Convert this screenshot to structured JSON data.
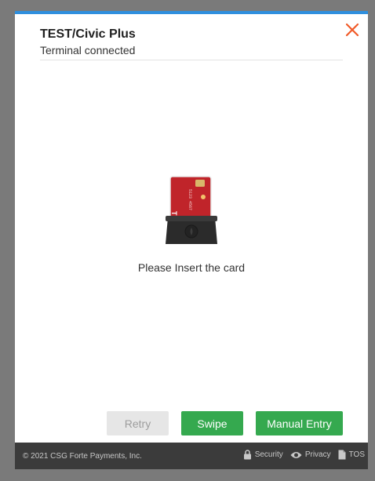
{
  "dialog": {
    "title": "TEST/Civic Plus",
    "status": "Terminal connected",
    "prompt": "Please Insert the card",
    "close_icon": "close-icon",
    "accent_color": "#2f8fde",
    "close_color": "#f05a28"
  },
  "card_illustration": {
    "brand_text": "TEK",
    "number_text": "5123 4567"
  },
  "buttons": {
    "retry_label": "Retry",
    "swipe_label": "Swipe",
    "manual_label": "Manual Entry",
    "primary_color": "#35a94f"
  },
  "footer": {
    "copyright": "© 2021 CSG Forte Payments, Inc.",
    "security_label": "Security",
    "privacy_label": "Privacy",
    "tos_label": "TOS"
  }
}
